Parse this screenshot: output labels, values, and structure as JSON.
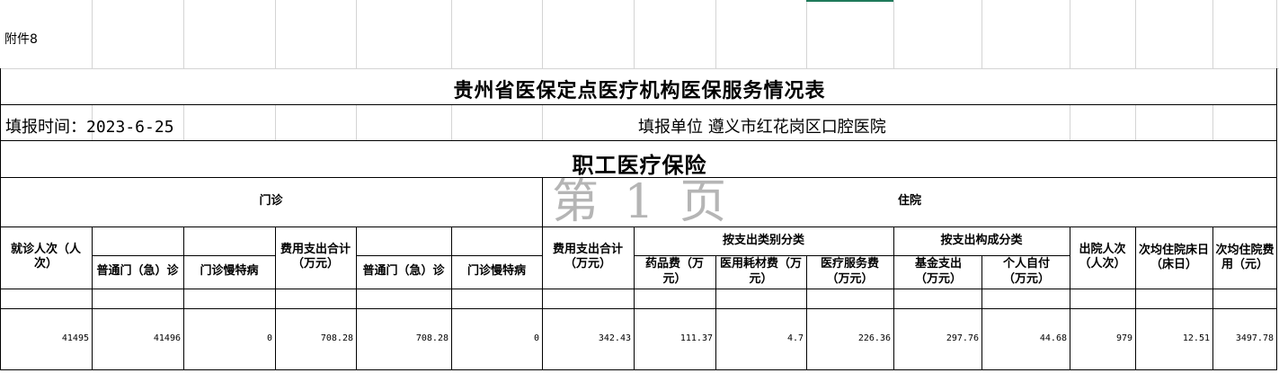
{
  "attachment_label": "附件8",
  "title": "贵州省医保定点医疗机构医保服务情况表",
  "fill_time": "填报时间：2023-6-25",
  "fill_unit": "填报单位 遵义市红花岗区口腔医院",
  "section_title": "职工医疗保险",
  "watermark": "第 1 页",
  "groups": {
    "outpatient": "门诊",
    "inpatient": "住院",
    "by_category": "按支出类别分类",
    "by_structure": "按支出构成分类"
  },
  "headers": {
    "visits": "就诊人次（人次）",
    "general_er_1": "普通门（急）诊",
    "chronic_1": "门诊慢特病",
    "op_expense_total": "费用支出合计（万元）",
    "general_er_2": "普通门（急）诊",
    "chronic_2": "门诊慢特病",
    "ip_expense_total": "费用支出合计（万元）",
    "drug": "药品费（万元）",
    "consumables": "医用耗材费（万元）",
    "service": "医疗服务费（万元）",
    "fund": "基金支出（万元）",
    "self_pay": "个人自付（万元）",
    "discharges": "出院人次（人次）",
    "avg_bed_days": "次均住院床日（床日）",
    "avg_cost": "次均住院费用（元）"
  },
  "row": {
    "visits": "41495",
    "general_er_1": "41496",
    "chronic_1": "0",
    "op_expense_total": "708.28",
    "general_er_2": "708.28",
    "chronic_2": "0",
    "ip_expense_total": "342.43",
    "drug": "111.37",
    "consumables": "4.7",
    "service": "226.36",
    "fund": "297.76",
    "self_pay": "44.68",
    "discharges": "979",
    "avg_bed_days": "12.51",
    "avg_cost": "3497.78"
  }
}
